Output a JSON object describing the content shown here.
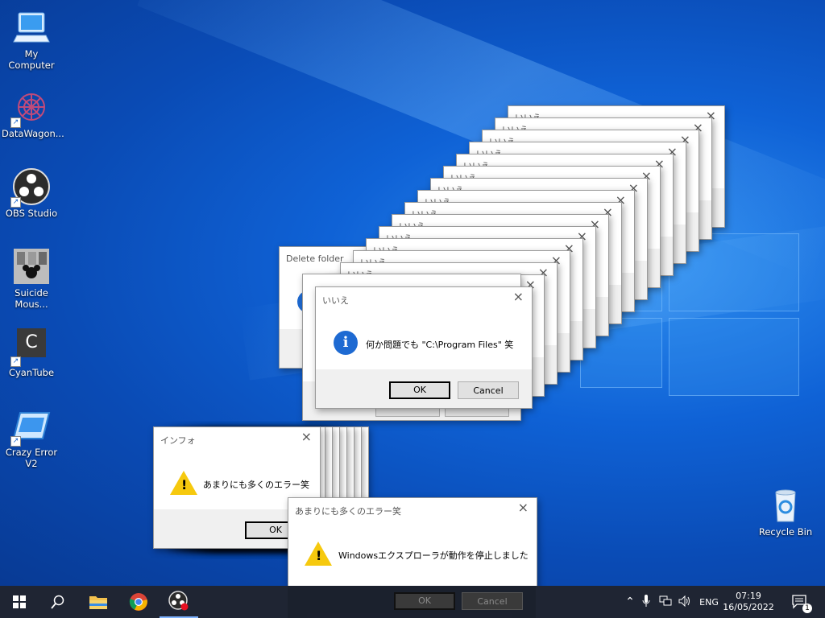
{
  "desktop_icons": [
    {
      "label": "My Computer",
      "icon": "computer-icon"
    },
    {
      "label": "DataWagon...",
      "icon": "datawagon-icon"
    },
    {
      "label": "OBS Studio",
      "icon": "obs-icon"
    },
    {
      "label": "Suicide Mous...",
      "icon": "suicide-mouse-icon"
    },
    {
      "label": "CyanTube",
      "icon": "cyantube-icon",
      "letter": "C"
    },
    {
      "label": "Crazy Error V2",
      "icon": "crazy-error-icon"
    },
    {
      "label": "Recycle Bin",
      "icon": "recycle-bin-icon"
    }
  ],
  "stack_title": "いいえ",
  "delete_dialog": {
    "title": "Delete folder",
    "icon": "question-icon"
  },
  "main_dialog": {
    "title": "いいえ",
    "message": "何か問題でも \"C:\\Program Files\" 笑",
    "icon": "info-icon",
    "ok_label": "OK",
    "cancel_label": "Cancel"
  },
  "info_dialog": {
    "title": "インフォ",
    "message": "あまりにも多くのエラー笑",
    "icon": "warning-icon",
    "ok_label": "OK"
  },
  "explorer_dialog": {
    "title": "あまりにも多くのエラー笑",
    "message": "Windowsエクスプローラが動作を停止しました",
    "icon": "warning-icon",
    "ok_label": "OK",
    "cancel_label": "Cancel"
  },
  "taskbar": {
    "apps": [
      "start-icon",
      "search-icon",
      "file-explorer-icon",
      "chrome-icon",
      "obs-icon"
    ],
    "language": "ENG",
    "time": "07:19",
    "date": "16/05/2022",
    "notification_count": "1"
  }
}
